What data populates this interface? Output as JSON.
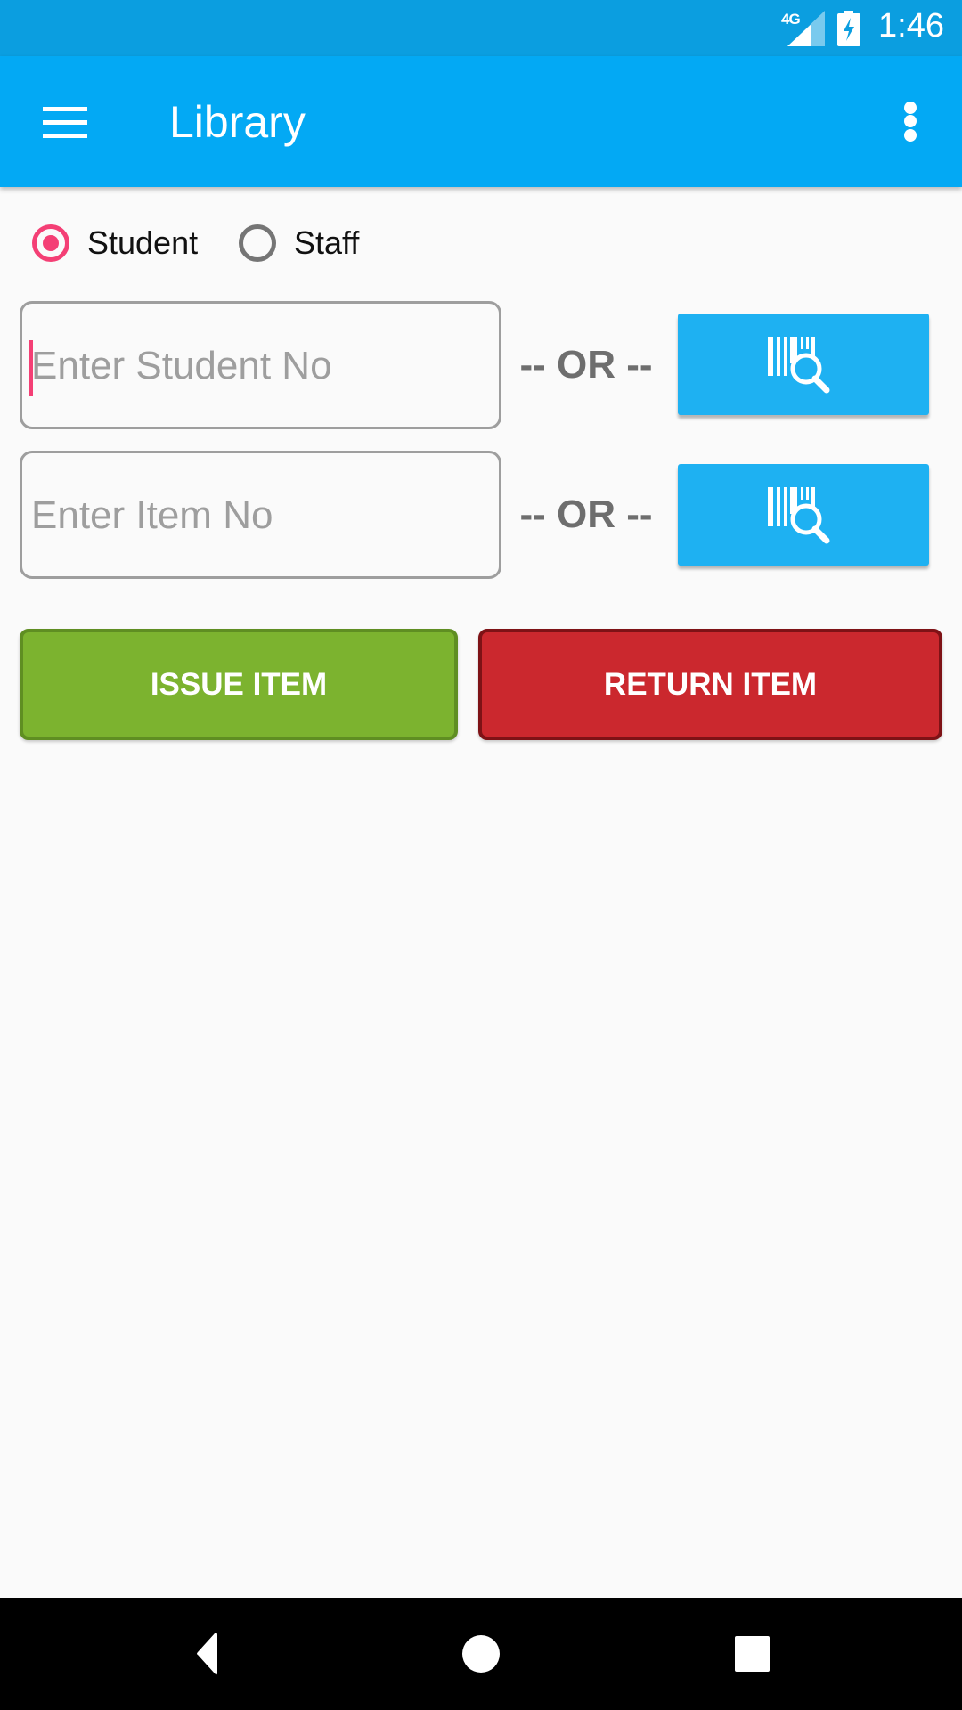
{
  "status_bar": {
    "network": "4G",
    "time": "1:46",
    "icons": [
      "signal-icon",
      "battery-charging-icon"
    ]
  },
  "app_bar": {
    "title": "Library",
    "menu_icon": "hamburger-menu-icon",
    "overflow_icon": "more-vert-icon"
  },
  "member_type": {
    "options": [
      {
        "label": "Student",
        "checked": true
      },
      {
        "label": "Staff",
        "checked": false
      }
    ]
  },
  "student_row": {
    "input_value": "",
    "placeholder": "Enter Student No",
    "or_label": "-- OR --",
    "scan_icon": "barcode-search-icon"
  },
  "item_row": {
    "input_value": "",
    "placeholder": "Enter Item No",
    "or_label": "-- OR --",
    "scan_icon": "barcode-search-icon"
  },
  "actions": {
    "issue_label": "ISSUE ITEM",
    "return_label": "RETURN ITEM"
  },
  "colors": {
    "primary": "#03A9F4",
    "status_bar": "#0B9EE0",
    "accent": "#F43F75",
    "issue": "#7CB32F",
    "return": "#CB282E"
  },
  "nav_bar": {
    "buttons": [
      "back-icon",
      "home-icon",
      "recents-icon"
    ]
  }
}
